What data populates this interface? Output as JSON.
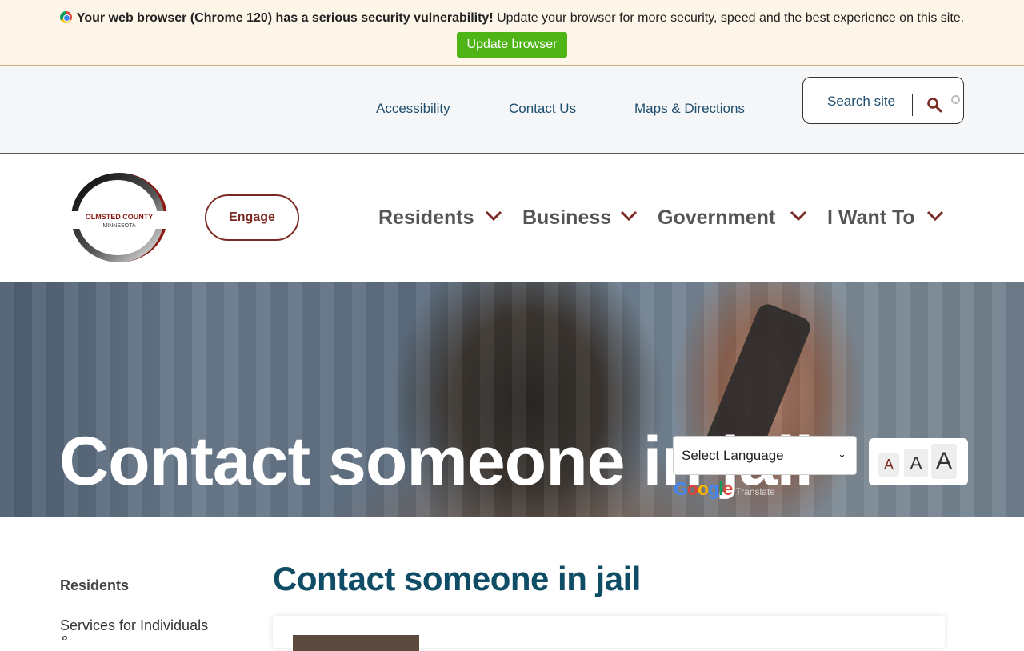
{
  "banner": {
    "icon": "chrome-icon",
    "warning_bold": "Your web browser (Chrome 120) has a serious security vulnerability!",
    "warning_text": " Update your browser for more security, speed and the best experience on this site.",
    "button_label": "Update browser",
    "button_color": "#4fb415",
    "background": "#fdf6e8"
  },
  "utility_nav": {
    "links": [
      "Accessibility",
      "Contact Us",
      "Maps & Directions"
    ],
    "search_label": "Search site",
    "search_icon": "search-icon"
  },
  "logo": {
    "line1": "OLMSTED COUNTY",
    "line2": "MINNESOTA",
    "accent": "#8b1a12"
  },
  "main_nav": {
    "engage_label": "Engage",
    "items": [
      "Residents",
      "Business",
      "Government",
      "I Want To"
    ],
    "item_icon": "chevron-down-icon",
    "accent": "#7a2a22"
  },
  "hero": {
    "title": "Contact someone in jail"
  },
  "translate": {
    "selected": "Select Language",
    "brand": "Google",
    "brand_suffix": "Translate"
  },
  "text_size": {
    "small": "A",
    "medium": "A",
    "large": "A"
  },
  "sidebar": {
    "heading": "Residents",
    "items": [
      {
        "label": "Services for Individuals &"
      }
    ]
  },
  "content": {
    "title": "Contact someone in jail",
    "title_color": "#0f4d66"
  }
}
